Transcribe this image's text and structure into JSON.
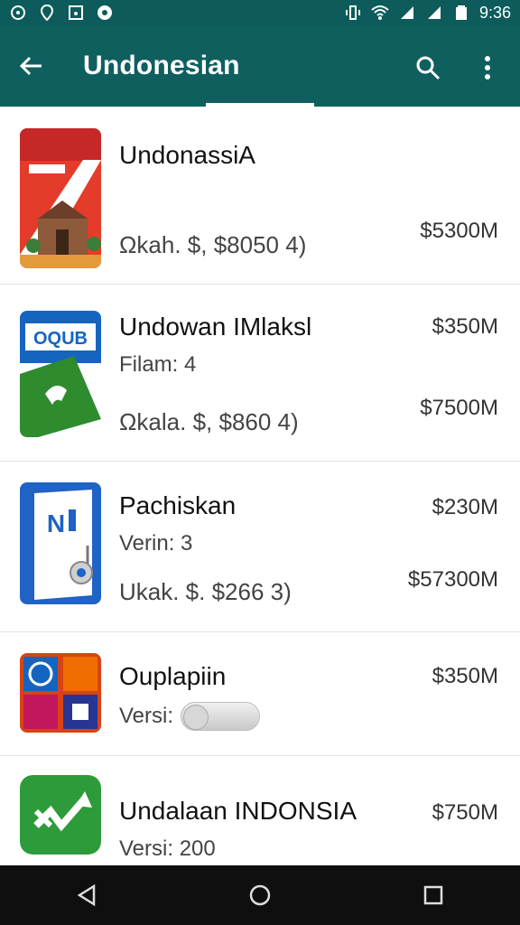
{
  "status_bar": {
    "time": "9:36",
    "left_icons": [
      "notification-icon",
      "location-icon",
      "image-icon",
      "record-icon"
    ],
    "right_icons": [
      "vibrate-icon",
      "wifi-icon",
      "signal-icon",
      "signal-icon",
      "battery-icon"
    ]
  },
  "app_bar": {
    "title": "Undonesian",
    "back_icon": "arrow-left-icon",
    "search_icon": "search-icon",
    "more_icon": "more-vertical-icon"
  },
  "items": [
    {
      "title": "UndonassiA",
      "meta": "Ωkah. $, $8050 4)",
      "price_bottom": "$5300M",
      "icon": "indonesia-landmark-icon"
    },
    {
      "title": "Undowan IMlaksl",
      "subtitle": "Filam: 4",
      "meta": "Ωkala. $, $860 4)",
      "price_top": "$350M",
      "price_bottom": "$7500M",
      "icon": "phone-app-icon"
    },
    {
      "title": "Pachiskan",
      "subtitle": "Verin: 3",
      "meta": "Ukak. $. $266 3)",
      "price_top": "$230M",
      "price_bottom": "$57300M",
      "icon": "n-app-icon"
    },
    {
      "title": "Ouplapiin",
      "subtitle": "Versi:",
      "price_top": "$350M",
      "icon": "grid-app-icon",
      "toggle_on": false
    },
    {
      "title": "Undalaan INDONSIA",
      "subtitle": "Versi: 200",
      "price_top": "$750M",
      "icon": "green-arrow-app-icon"
    }
  ],
  "nav_bar": {
    "icons": [
      "back-triangle-icon",
      "home-circle-icon",
      "recents-square-icon"
    ]
  },
  "colors": {
    "app_bar": "#0f5f5f",
    "status_bar": "#0d5b5b",
    "nav_bar": "#0f0f0f"
  }
}
